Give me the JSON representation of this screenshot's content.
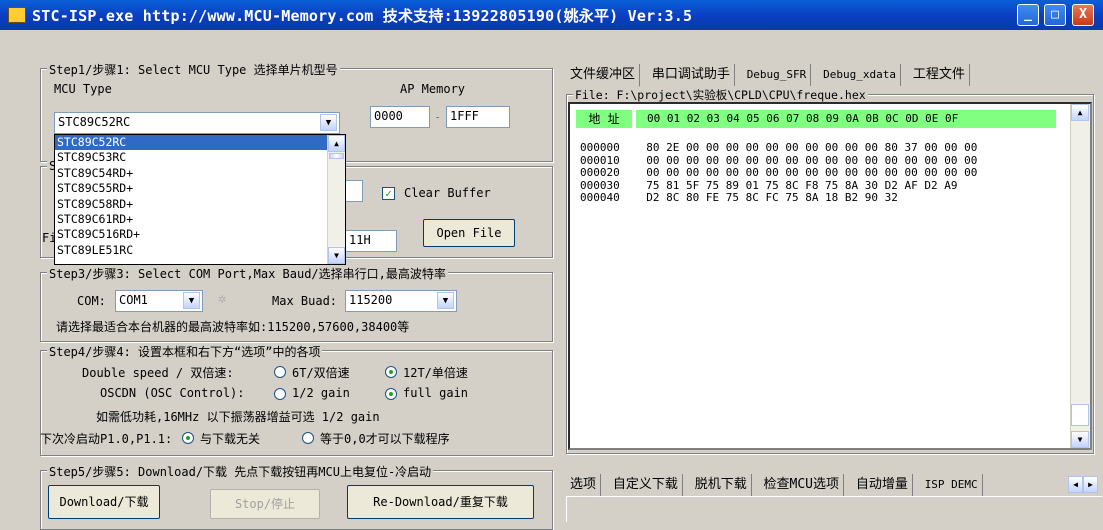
{
  "window": {
    "title": "STC-ISP.exe http://www.MCU-Memory.com 技术支持:13922805190(姚永平) Ver:3.5",
    "min_label": "_",
    "max_label": "□",
    "close_label": "X"
  },
  "step1": {
    "legend": "Step1/步骤1: Select MCU Type 选择单片机型号",
    "mcu_type_label": "MCU Type",
    "ap_memory_label": "AP Memory",
    "mcu_selected": "STC89C52RC",
    "ap_start": "0000",
    "ap_sep": "-",
    "ap_end": "1FFF",
    "dropdown_items": [
      "STC89C52RC",
      "STC89C53RC",
      "STC89C54RD+",
      "STC89C55RD+",
      "STC89C58RD+",
      "STC89C61RD+",
      "STC89C516RD+",
      "STC89LE51RC"
    ]
  },
  "step2": {
    "legend_partial": "S",
    "clear_buffer_label": "Clear Buffer",
    "clear_buffer_checked": true,
    "file_label_partial": "Fi",
    "offset_partial": "11H",
    "open_file_label": "Open File"
  },
  "step3": {
    "legend": "Step3/步骤3: Select COM Port,Max Baud/选择串行口,最高波特率",
    "com_label": "COM:",
    "com_value": "COM1",
    "max_baud_label": "Max Buad:",
    "max_baud_value": "115200",
    "hint": "请选择最适合本台机器的最高波特率如:115200,57600,38400等"
  },
  "step4": {
    "legend": "Step4/步骤4: 设置本框和右下方“选项”中的各项",
    "double_speed_label": "Double speed / 双倍速:",
    "opt_6t": "6T/双倍速",
    "opt_12t": "12T/单倍速",
    "oscdn_label": "OSCDN (OSC Control):",
    "opt_half_gain": "1/2 gain",
    "opt_full_gain": "full gain",
    "low_power_hint": "如需低功耗,16MHz 以下振荡器增益可选 1/2 gain",
    "cold_boot_label": "下次冷启动P1.0,P1.1:",
    "opt_unrelated": "与下载无关",
    "opt_equal_zero": "等于0,0才可以下载程序"
  },
  "step5": {
    "legend": "Step5/步骤5: Download/下载  先点下载按钮再MCU上电复位-冷启动",
    "download_label": "Download/下载",
    "stop_label": "Stop/停止",
    "redownload_label": "Re-Download/重复下载"
  },
  "right_tabs": [
    "文件缓冲区",
    "串口调试助手",
    "Debug_SFR",
    "Debug_xdata",
    "工程文件"
  ],
  "file": {
    "legend": "File: F:\\project\\实验板\\CPLD\\CPU\\freque.hex",
    "addr_header": "地 址",
    "col_header": "00 01 02 03 04 05 06 07 08 09 0A 0B 0C 0D 0E 0F",
    "rows": [
      {
        "addr": "000000",
        "bytes": "80 2E 00 00 00 00 00 00 00 00 00 00 80 37 00 00 00"
      },
      {
        "addr": "000010",
        "bytes": "00 00 00 00 00 00 00 00 00 00 00 00 00 00 00 00 00"
      },
      {
        "addr": "000020",
        "bytes": "00 00 00 00 00 00 00 00 00 00 00 00 00 00 00 00 00"
      },
      {
        "addr": "000030",
        "bytes": "75 81 5F 75 89 01 75 8C F8 75 8A 30 D2 AF D2 A9"
      },
      {
        "addr": "000040",
        "bytes": "D2 8C 80 FE 75 8C FC 75 8A 18 B2 90 32"
      }
    ]
  },
  "bottom_tabs": [
    "选项",
    "自定义下载",
    "脱机下载",
    "检查MCU选项",
    "自动增量",
    "ISP DEMC"
  ]
}
